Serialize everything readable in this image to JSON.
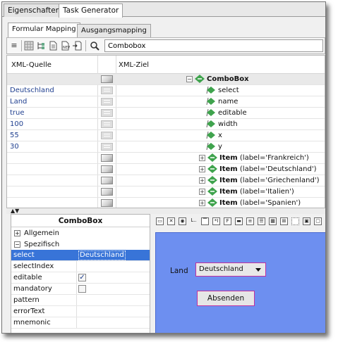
{
  "tabs": [
    "Eigenschaften",
    "Task Generator"
  ],
  "subtabs": [
    "Formular Mapping",
    "Ausgangsmapping"
  ],
  "toolbar": {
    "search_value": "Combobox",
    "icons": [
      "list-icon",
      "grid-icon",
      "tree-icon",
      "document-icon",
      "new-document-icon",
      "import-icon",
      "search-icon"
    ]
  },
  "mapping": {
    "col_source": "XML-Quelle",
    "col_target": "XML-Ziel",
    "root": "ComboBox",
    "rows": [
      {
        "source": "",
        "target": "ComboBox",
        "kind": "root"
      },
      {
        "source": "Deutschland",
        "target": "select",
        "kind": "leaf"
      },
      {
        "source": "Land",
        "target": "name",
        "kind": "leaf"
      },
      {
        "source": "true",
        "target": "editable",
        "kind": "leaf"
      },
      {
        "source": "100",
        "target": "width",
        "kind": "leaf"
      },
      {
        "source": "55",
        "target": "x",
        "kind": "leaf"
      },
      {
        "source": "30",
        "target": "y",
        "kind": "leaf"
      },
      {
        "source": "",
        "target": "Item",
        "attr": "(label='Frankreich')",
        "kind": "item"
      },
      {
        "source": "",
        "target": "Item",
        "attr": "(label='Deutschland')",
        "kind": "item"
      },
      {
        "source": "",
        "target": "Item",
        "attr": "(label='Griechenland')",
        "kind": "item"
      },
      {
        "source": "",
        "target": "Item",
        "attr": "(label='Italien')",
        "kind": "item"
      },
      {
        "source": "",
        "target": "Item",
        "attr": "(label='Spanien')",
        "kind": "item"
      }
    ]
  },
  "properties": {
    "title": "ComboBox",
    "groups": {
      "general": "Allgemein",
      "specific": "Spezifisch"
    },
    "items": [
      {
        "key": "select",
        "value": "Deutschland"
      },
      {
        "key": "selectIndex",
        "value": ""
      },
      {
        "key": "editable",
        "value": "checked"
      },
      {
        "key": "mandatory",
        "value": "unchecked"
      },
      {
        "key": "pattern",
        "value": ""
      },
      {
        "key": "errorText",
        "value": ""
      },
      {
        "key": "mnemonic",
        "value": ""
      }
    ]
  },
  "designer": {
    "label": "Land",
    "combo_value": "Deutschland",
    "button_label": "Absenden",
    "canvas_color": "#6d8ff0"
  }
}
